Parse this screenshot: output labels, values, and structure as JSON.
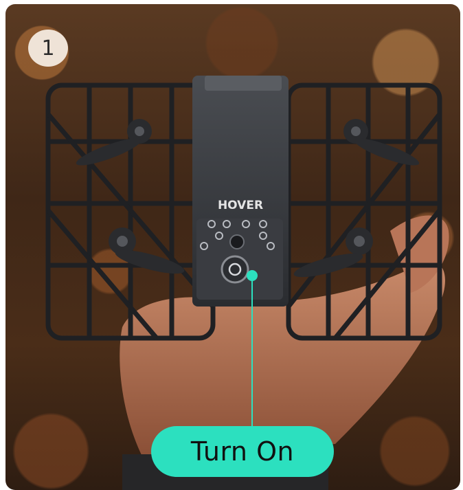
{
  "step": {
    "number": "1"
  },
  "product": {
    "brand": "HOVER"
  },
  "action": {
    "label": "Turn On"
  },
  "colors": {
    "accent": "#2ce0bf",
    "badge_bg": "#efe3d7",
    "background": "#4a2d18"
  }
}
